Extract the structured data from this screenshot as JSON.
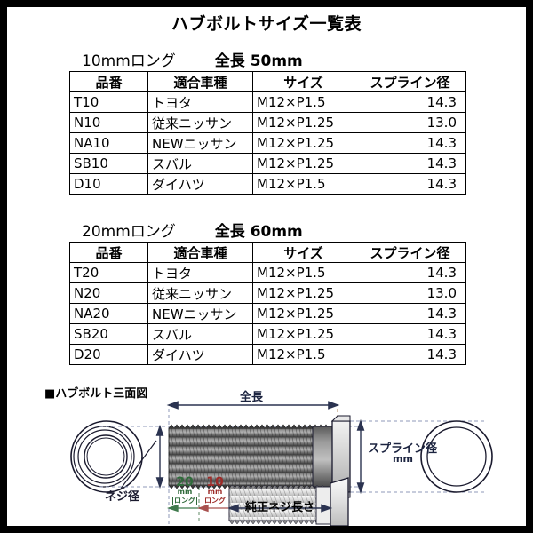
{
  "document": {
    "title": "ハブボルトサイズ一覧表"
  },
  "sections": [
    {
      "name": "10mm long",
      "label": "10mmロング",
      "overall_length_label": "全長",
      "overall_length_value": "50mm",
      "table": {
        "headers": [
          "品番",
          "適合車種",
          "サイズ",
          "スプライン径"
        ],
        "rows": [
          {
            "part": "T10",
            "vehicle": "トヨタ",
            "size": "M12×P1.5",
            "spline": "14.3"
          },
          {
            "part": "N10",
            "vehicle": "従来ニッサン",
            "size": "M12×P1.25",
            "spline": "13.0"
          },
          {
            "part": "NA10",
            "vehicle": "NEWニッサン",
            "size": "M12×P1.25",
            "spline": "14.3"
          },
          {
            "part": "SB10",
            "vehicle": "スバル",
            "size": "M12×P1.25",
            "spline": "14.3"
          },
          {
            "part": "D10",
            "vehicle": "ダイハツ",
            "size": "M12×P1.5",
            "spline": "14.3"
          }
        ]
      }
    },
    {
      "name": "20mm long",
      "label": "20mmロング",
      "overall_length_label": "全長",
      "overall_length_value": "60mm",
      "table": {
        "headers": [
          "品番",
          "適合車種",
          "サイズ",
          "スプライン径"
        ],
        "rows": [
          {
            "part": "T20",
            "vehicle": "トヨタ",
            "size": "M12×P1.5",
            "spline": "14.3"
          },
          {
            "part": "N20",
            "vehicle": "従来ニッサン",
            "size": "M12×P1.25",
            "spline": "13.0"
          },
          {
            "part": "NA20",
            "vehicle": "NEWニッサン",
            "size": "M12×P1.25",
            "spline": "14.3"
          },
          {
            "part": "SB20",
            "vehicle": "スバル",
            "size": "M12×P1.25",
            "spline": "14.3"
          },
          {
            "part": "D20",
            "vehicle": "ダイハツ",
            "size": "M12×P1.5",
            "spline": "14.3"
          }
        ]
      }
    }
  ],
  "diagram": {
    "title": "■ハブボルト三面図",
    "labels": {
      "overall_length": "全長",
      "thread_diameter": "ネジ径",
      "spline_diameter": "スプライン径",
      "spline_diameter_unit": "mm",
      "genuine_thread_length": "純正ネジ長さ"
    },
    "extension_tags": [
      {
        "num": "20",
        "unit": "mm",
        "jp": "ロング",
        "color": "#2f6b3a"
      },
      {
        "num": "10",
        "unit": "mm",
        "jp": "ロング",
        "color": "#9d2b28"
      }
    ]
  },
  "colors": {
    "page_background": "#ffffff",
    "frame": "#000000",
    "ink": "#000000",
    "dim_line": "#2b3350",
    "green_tag": "#2f6b3a",
    "red_tag": "#9d2b28",
    "bolt_body": "#6b6b6b",
    "bolt_outline": "#1a1a2e"
  }
}
